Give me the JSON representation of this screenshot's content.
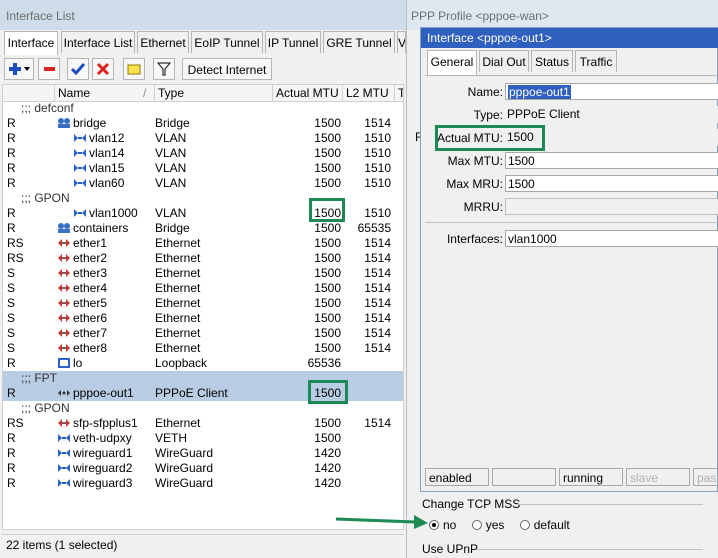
{
  "interface_list": {
    "title": "Interface List",
    "tabs": [
      "Interface",
      "Interface List",
      "Ethernet",
      "EoIP Tunnel",
      "IP Tunnel",
      "GRE Tunnel",
      "V"
    ],
    "toolbar": {
      "detect_label": "Detect Internet"
    },
    "columns": {
      "name": "Name",
      "type": "Type",
      "mtu": "Actual MTU",
      "l2mtu": "L2 MTU",
      "tx": "Tx"
    },
    "rows": [
      {
        "kind": "comment",
        "text": ";;; defconf"
      },
      {
        "kind": "item",
        "flag": "R",
        "name": "bridge",
        "type": "Bridge",
        "mtu": "1500",
        "l2": "1514",
        "icon": "bridge-icon",
        "indent": 0
      },
      {
        "kind": "item",
        "flag": "R",
        "name": "vlan12",
        "type": "VLAN",
        "mtu": "1500",
        "l2": "1510",
        "icon": "vlan-icon",
        "indent": 1
      },
      {
        "kind": "item",
        "flag": "R",
        "name": "vlan14",
        "type": "VLAN",
        "mtu": "1500",
        "l2": "1510",
        "icon": "vlan-icon",
        "indent": 1
      },
      {
        "kind": "item",
        "flag": "R",
        "name": "vlan15",
        "type": "VLAN",
        "mtu": "1500",
        "l2": "1510",
        "icon": "vlan-icon",
        "indent": 1
      },
      {
        "kind": "item",
        "flag": "R",
        "name": "vlan60",
        "type": "VLAN",
        "mtu": "1500",
        "l2": "1510",
        "icon": "vlan-icon",
        "indent": 1
      },
      {
        "kind": "comment",
        "text": ";;; GPON"
      },
      {
        "kind": "item",
        "flag": "R",
        "name": "vlan1000",
        "type": "VLAN",
        "mtu": "1500",
        "l2": "1510",
        "icon": "vlan-icon",
        "indent": 1
      },
      {
        "kind": "item",
        "flag": "R",
        "name": "containers",
        "type": "Bridge",
        "mtu": "1500",
        "l2": "65535",
        "icon": "bridge-icon",
        "indent": 0
      },
      {
        "kind": "item",
        "flag": "RS",
        "name": "ether1",
        "type": "Ethernet",
        "mtu": "1500",
        "l2": "1514",
        "icon": "ethernet-icon",
        "indent": 0
      },
      {
        "kind": "item",
        "flag": "RS",
        "name": "ether2",
        "type": "Ethernet",
        "mtu": "1500",
        "l2": "1514",
        "icon": "ethernet-icon",
        "indent": 0
      },
      {
        "kind": "item",
        "flag": "S",
        "name": "ether3",
        "type": "Ethernet",
        "mtu": "1500",
        "l2": "1514",
        "icon": "ethernet-icon",
        "indent": 0
      },
      {
        "kind": "item",
        "flag": "S",
        "name": "ether4",
        "type": "Ethernet",
        "mtu": "1500",
        "l2": "1514",
        "icon": "ethernet-icon",
        "indent": 0
      },
      {
        "kind": "item",
        "flag": "S",
        "name": "ether5",
        "type": "Ethernet",
        "mtu": "1500",
        "l2": "1514",
        "icon": "ethernet-icon",
        "indent": 0
      },
      {
        "kind": "item",
        "flag": "S",
        "name": "ether6",
        "type": "Ethernet",
        "mtu": "1500",
        "l2": "1514",
        "icon": "ethernet-icon",
        "indent": 0
      },
      {
        "kind": "item",
        "flag": "S",
        "name": "ether7",
        "type": "Ethernet",
        "mtu": "1500",
        "l2": "1514",
        "icon": "ethernet-icon",
        "indent": 0
      },
      {
        "kind": "item",
        "flag": "S",
        "name": "ether8",
        "type": "Ethernet",
        "mtu": "1500",
        "l2": "1514",
        "icon": "ethernet-icon",
        "indent": 0
      },
      {
        "kind": "item",
        "flag": "R",
        "name": "lo",
        "type": "Loopback",
        "mtu": "65536",
        "l2": "",
        "icon": "loopback-icon",
        "indent": 0
      },
      {
        "kind": "comment",
        "text": ";;; FPT",
        "selected": true
      },
      {
        "kind": "item",
        "flag": "R",
        "name": "pppoe-out1",
        "type": "PPPoE Client",
        "mtu": "1500",
        "l2": "",
        "icon": "pppoe-icon",
        "indent": 0,
        "selected": true
      },
      {
        "kind": "comment",
        "text": ";;; GPON"
      },
      {
        "kind": "item",
        "flag": "RS",
        "name": "sfp-sfpplus1",
        "type": "Ethernet",
        "mtu": "1500",
        "l2": "1514",
        "icon": "ethernet-icon",
        "indent": 0
      },
      {
        "kind": "item",
        "flag": "R",
        "name": "veth-udpxy",
        "type": "VETH",
        "mtu": "1500",
        "l2": "",
        "icon": "veth-icon",
        "indent": 0
      },
      {
        "kind": "item",
        "flag": "R",
        "name": "wireguard1",
        "type": "WireGuard",
        "mtu": "1420",
        "l2": "",
        "icon": "wireguard-icon",
        "indent": 0
      },
      {
        "kind": "item",
        "flag": "R",
        "name": "wireguard2",
        "type": "WireGuard",
        "mtu": "1420",
        "l2": "",
        "icon": "wireguard-icon",
        "indent": 0
      },
      {
        "kind": "item",
        "flag": "R",
        "name": "wireguard3",
        "type": "WireGuard",
        "mtu": "1420",
        "l2": "",
        "icon": "wireguard-icon",
        "indent": 0
      }
    ],
    "status": "22 items (1 selected)"
  },
  "ppp_profile": {
    "title": "PPP Profile <pppoe-wan>",
    "side_label": "R",
    "tcp_mss": {
      "title": "Change TCP MSS",
      "options": [
        "no",
        "yes",
        "default"
      ],
      "selected": "no"
    },
    "upnp_title": "Use UPnP"
  },
  "pppoe_window": {
    "title": "Interface <pppoe-out1>",
    "tabs": [
      "General",
      "Dial Out",
      "Status",
      "Traffic"
    ],
    "fields": {
      "name_label": "Name:",
      "name_value": "pppoe-out1",
      "type_label": "Type:",
      "type_value": "PPPoE Client",
      "mtu_label": "Actual MTU:",
      "mtu_value": "1500",
      "maxmtu_label": "Max MTU:",
      "maxmtu_value": "1500",
      "maxmru_label": "Max MRU:",
      "maxmru_value": "1500",
      "mrru_label": "MRRU:",
      "mrru_value": "",
      "interfaces_label": "Interfaces:",
      "interfaces_value": "vlan1000"
    },
    "status": [
      "enabled",
      "",
      "running",
      "slave",
      "passt"
    ]
  },
  "colors": {
    "highlight": "#1d8a55",
    "title_active": "#2f5fbf",
    "selection": "#b8cce4"
  }
}
